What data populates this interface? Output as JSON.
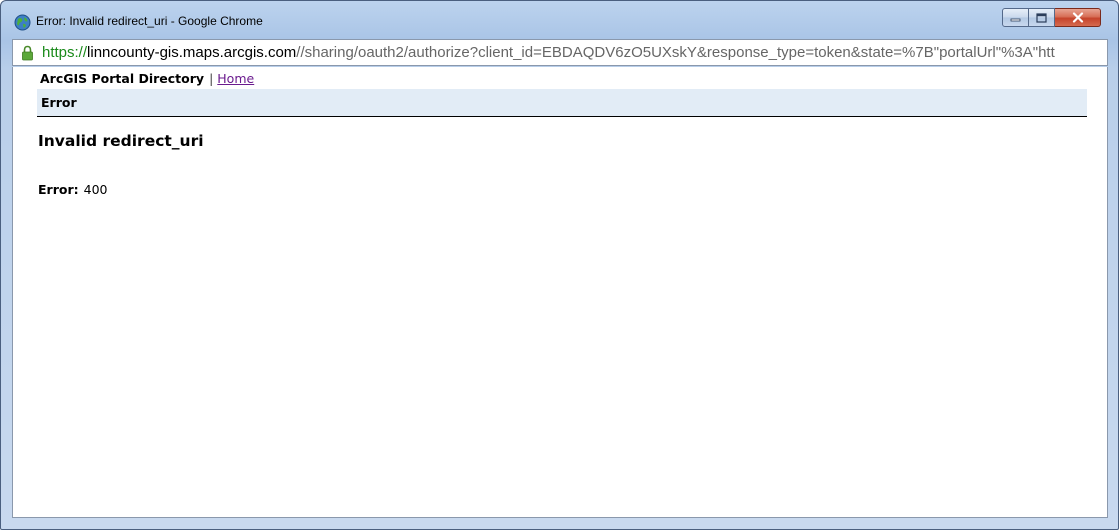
{
  "window": {
    "title": "Error: Invalid redirect_uri - Google Chrome"
  },
  "address": {
    "scheme": "https://",
    "host": "linncounty-gis.maps.arcgis.com",
    "path": "//sharing/oauth2/authorize?client_id=EBDAQDV6zO5UXskY&response_type=token&state=%7B\"portalUrl\"%3A\"htt"
  },
  "nav": {
    "directory_label": "ArcGIS Portal Directory",
    "separator": "|",
    "home_link": "Home"
  },
  "errbar": {
    "label": "Error"
  },
  "main": {
    "heading": "Invalid redirect_uri",
    "error_label": "Error:",
    "error_code": "400"
  },
  "colors": {
    "link_visited": "#6a1a8e",
    "scheme_green": "#1a8a1a",
    "header_band": "#e2ecf6"
  }
}
